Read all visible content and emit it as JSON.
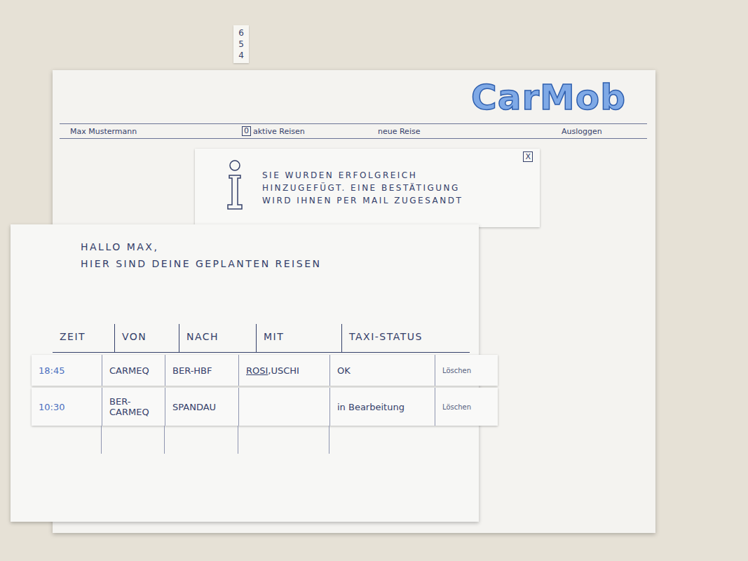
{
  "tab_strip": [
    "6",
    "5",
    "4"
  ],
  "logo": "CarMob",
  "nav": {
    "user": "Max Mustermann",
    "active_count": "0",
    "active_label": "aktive Reisen",
    "new_trip": "neue Reise",
    "logout": "Ausloggen"
  },
  "notice": {
    "lines": [
      "SIE WURDEN ERFOLGREICH",
      "HINZUGEFÜGT. EINE BESTÄTIGUNG",
      "WIRD IHNEN PER MAIL ZUGESANDT"
    ],
    "close": "X"
  },
  "greeting": "HALLO MAX,",
  "subtitle": "HIER SIND DEINE GEPLANTEN REISEN",
  "table": {
    "columns": [
      "ZEIT",
      "VON",
      "NACH",
      "MIT",
      "TAXI-STATUS"
    ],
    "separator": ", ",
    "rows": [
      {
        "zeit": "18:45",
        "von": "CARMEQ",
        "nach": "BER-HBF",
        "mit": [
          {
            "name": "ROSI",
            "linked": true
          },
          {
            "name": "USCHI",
            "linked": false
          }
        ],
        "status": "OK",
        "action": "Löschen"
      },
      {
        "zeit": "10:30",
        "von": "BER-CARMEQ",
        "nach": "SPANDAU",
        "mit": [],
        "status": "in Bearbeitung",
        "action": "Löschen"
      }
    ]
  }
}
